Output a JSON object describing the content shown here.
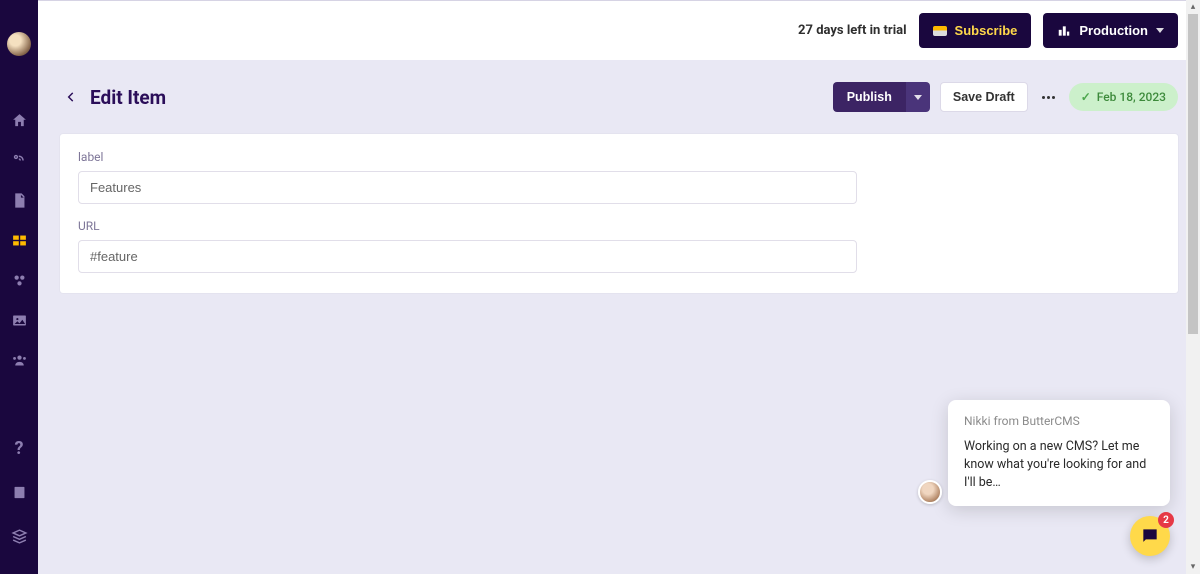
{
  "topbar": {
    "trial_text": "27 days left in trial",
    "subscribe_label": "Subscribe",
    "environment_label": "Production"
  },
  "page": {
    "title": "Edit Item",
    "publish_label": "Publish",
    "save_draft_label": "Save Draft",
    "status_date": "Feb 18, 2023"
  },
  "form": {
    "label_field": {
      "label": "label",
      "value": "Features"
    },
    "url_field": {
      "label": "URL",
      "value": "#feature"
    }
  },
  "chat": {
    "from": "Nikki from ButterCMS",
    "message": "Working on a new CMS? Let me know what you're looking for and I'll be…",
    "badge_count": "2"
  }
}
